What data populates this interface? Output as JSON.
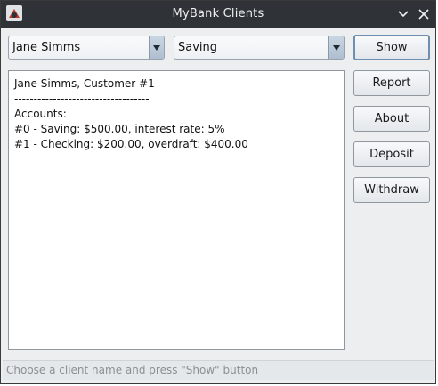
{
  "window": {
    "title": "MyBank Clients",
    "icons": {
      "app": "app-logo-icon",
      "minimize": "chevron-down-icon",
      "close": "close-icon"
    }
  },
  "client_select": {
    "value": "Jane Simms"
  },
  "account_type_select": {
    "value": "Saving"
  },
  "buttons": {
    "show": "Show",
    "report": "Report",
    "about": "About",
    "deposit": "Deposit",
    "withdraw": "Withdraw"
  },
  "output": {
    "lines": [
      "Jane Simms, Customer #1",
      "-----------------------------------",
      "Accounts:",
      "#0 - Saving: $500.00, interest rate: 5%",
      "#1 - Checking: $200.00, overdraft: $400.00"
    ]
  },
  "status": {
    "text": "Choose a client name and press \"Show\" button"
  }
}
